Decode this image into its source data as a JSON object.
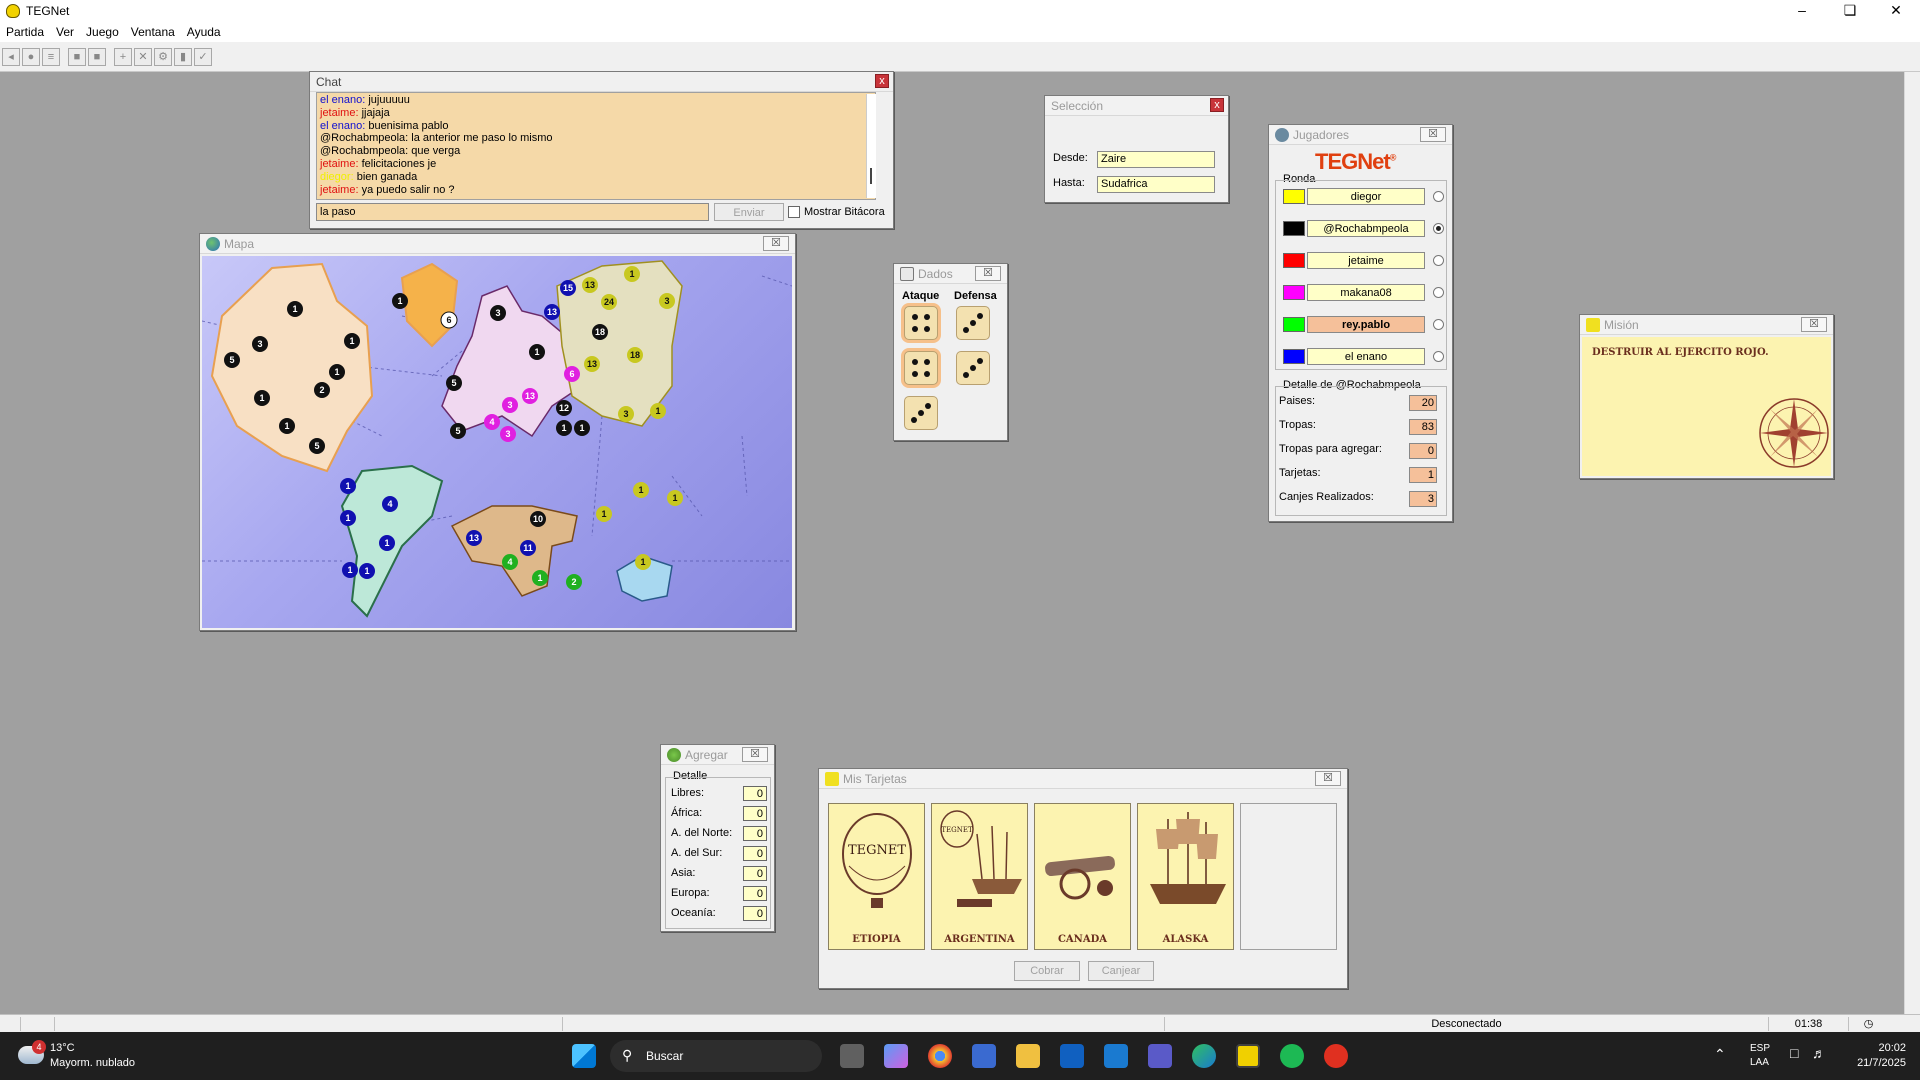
{
  "app": {
    "title": "TEGNet"
  },
  "menu": [
    "Partida",
    "Ver",
    "Juego",
    "Ventana",
    "Ayuda"
  ],
  "chat": {
    "title": "Chat",
    "messages": [
      {
        "user": "el enano:",
        "text": "jujuuuuu",
        "color": "#1010d0"
      },
      {
        "user": "jetaime:",
        "text": "jjajaja",
        "color": "#e01010"
      },
      {
        "user": "el enano:",
        "text": "buenisima pablo",
        "color": "#1010d0"
      },
      {
        "user": "@Rochabmpeola:",
        "text": "la anterior me paso lo mismo",
        "color": "#000000"
      },
      {
        "user": "@Rochabmpeola:",
        "text": "que verga",
        "color": "#000000"
      },
      {
        "user": "jetaime:",
        "text": "felicitaciones je",
        "color": "#e01010"
      },
      {
        "user": "diegor:",
        "text": "bien ganada",
        "color": "#f0f000"
      },
      {
        "user": "jetaime:",
        "text": "ya puedo salir no ?",
        "color": "#e01010"
      }
    ],
    "input_value": "la paso",
    "send_label": "Enviar",
    "log_label": "Mostrar Bitácora"
  },
  "seleccion": {
    "title": "Selección",
    "desde_label": "Desde:",
    "desde": "Zaire",
    "hasta_label": "Hasta:",
    "hasta": "Sudafrica"
  },
  "mapa": {
    "title": "Mapa"
  },
  "dados": {
    "title": "Dados",
    "ataque_label": "Ataque",
    "defensa_label": "Defensa",
    "ataque": [
      4,
      4,
      3
    ],
    "defensa": [
      3,
      3
    ]
  },
  "jugadores": {
    "title": "Jugadores",
    "logo": "TEGNet",
    "logo_mark": "®",
    "ronda_label": "Ronda",
    "players": [
      {
        "name": "diegor",
        "color": "#ffff00",
        "active": false
      },
      {
        "name": "@Rochabmpeola",
        "color": "#000000",
        "active": true
      },
      {
        "name": "jetaime",
        "color": "#ff0000",
        "active": false
      },
      {
        "name": "makana08",
        "color": "#ff00ff",
        "active": false
      },
      {
        "name": "rey.pablo",
        "color": "#00ff00",
        "active": false
      },
      {
        "name": "el enano",
        "color": "#0000ff",
        "active": false
      }
    ],
    "detalle_label": "Detalle de @Rochabmpeola",
    "detalle": [
      {
        "label": "Paises:",
        "value": "20"
      },
      {
        "label": "Tropas:",
        "value": "83"
      },
      {
        "label": "Tropas para agregar:",
        "value": "0"
      },
      {
        "label": "Tarjetas:",
        "value": "1"
      },
      {
        "label": "Canjes Realizados:",
        "value": "3"
      }
    ]
  },
  "mision": {
    "title": "Misión",
    "text": "DESTRUIR AL EJERCITO ROJO."
  },
  "agregar": {
    "title": "Agregar",
    "detalle_label": "Detalle",
    "rows": [
      {
        "label": "Libres:",
        "value": "0"
      },
      {
        "label": "África:",
        "value": "0"
      },
      {
        "label": "A. del Norte:",
        "value": "0"
      },
      {
        "label": "A. del Sur:",
        "value": "0"
      },
      {
        "label": "Asia:",
        "value": "0"
      },
      {
        "label": "Europa:",
        "value": "0"
      },
      {
        "label": "Oceanía:",
        "value": "0"
      }
    ]
  },
  "tarjetas": {
    "title": "Mis Tarjetas",
    "cards": [
      "ETIOPIA",
      "ARGENTINA",
      "CANADA",
      "ALASKA"
    ],
    "balloon_text": "TEGNET",
    "cobrar_label": "Cobrar",
    "canjear_label": "Canjear"
  },
  "status": {
    "state": "Desconectado",
    "time": "01:38"
  },
  "taskbar": {
    "temp": "13°C",
    "weather": "Mayorm. nublado",
    "badge": "4",
    "search": "Buscar",
    "lang": "ESP",
    "lang2": "LAA",
    "clock": "20:02",
    "date": "21/7/2025"
  }
}
